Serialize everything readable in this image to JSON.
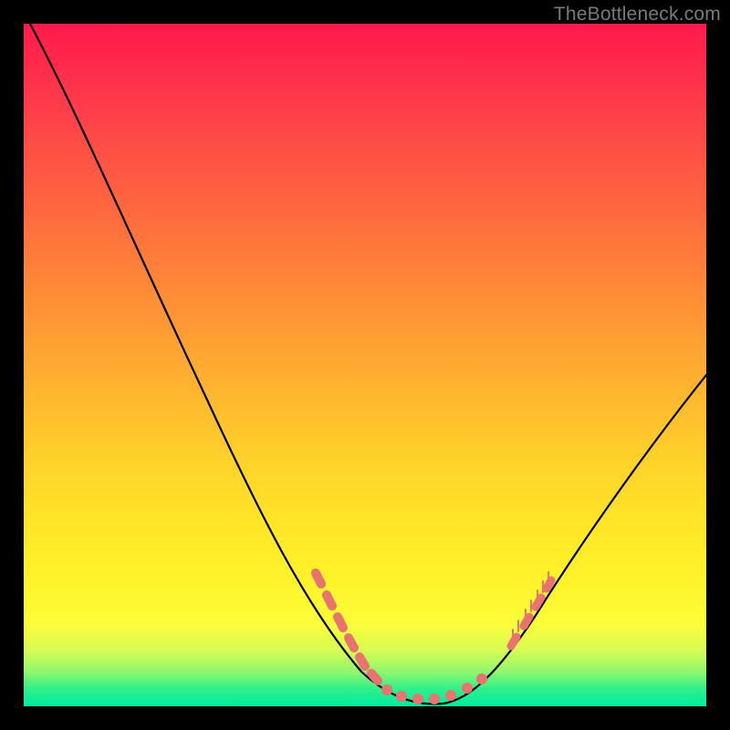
{
  "watermark": "TheBottleneck.com",
  "colors": {
    "frame": "#000000",
    "curve": "#000000",
    "markers": "#e9736f",
    "gradient_top": "#ff1a4d",
    "gradient_bottom": "#00eca0"
  },
  "chart_data": {
    "type": "line",
    "title": "",
    "xlabel": "",
    "ylabel": "",
    "xlim": [
      0,
      100
    ],
    "ylim": [
      0,
      100
    ],
    "series": [
      {
        "name": "bottleneck-curve",
        "x": [
          0,
          5,
          10,
          15,
          20,
          25,
          30,
          35,
          40,
          45,
          50,
          52,
          55,
          58,
          60,
          62,
          65,
          68,
          70,
          75,
          80,
          85,
          90,
          95,
          100
        ],
        "y": [
          100,
          93,
          84,
          75,
          65,
          55,
          45,
          35,
          26,
          17,
          9,
          6,
          3,
          1,
          0,
          0.5,
          2,
          5,
          8,
          15,
          22,
          30,
          37,
          44,
          50
        ]
      }
    ],
    "annotations": {
      "markers_region": [
        {
          "x": 42,
          "y": 20
        },
        {
          "x": 45,
          "y": 15
        },
        {
          "x": 48,
          "y": 10
        },
        {
          "x": 50,
          "y": 7
        },
        {
          "x": 52,
          "y": 5
        },
        {
          "x": 54,
          "y": 3
        },
        {
          "x": 57,
          "y": 1.5
        },
        {
          "x": 60,
          "y": 0.5
        },
        {
          "x": 63,
          "y": 1
        },
        {
          "x": 66,
          "y": 3
        },
        {
          "x": 70,
          "y": 8
        },
        {
          "x": 73,
          "y": 13
        },
        {
          "x": 76,
          "y": 17
        }
      ]
    }
  }
}
